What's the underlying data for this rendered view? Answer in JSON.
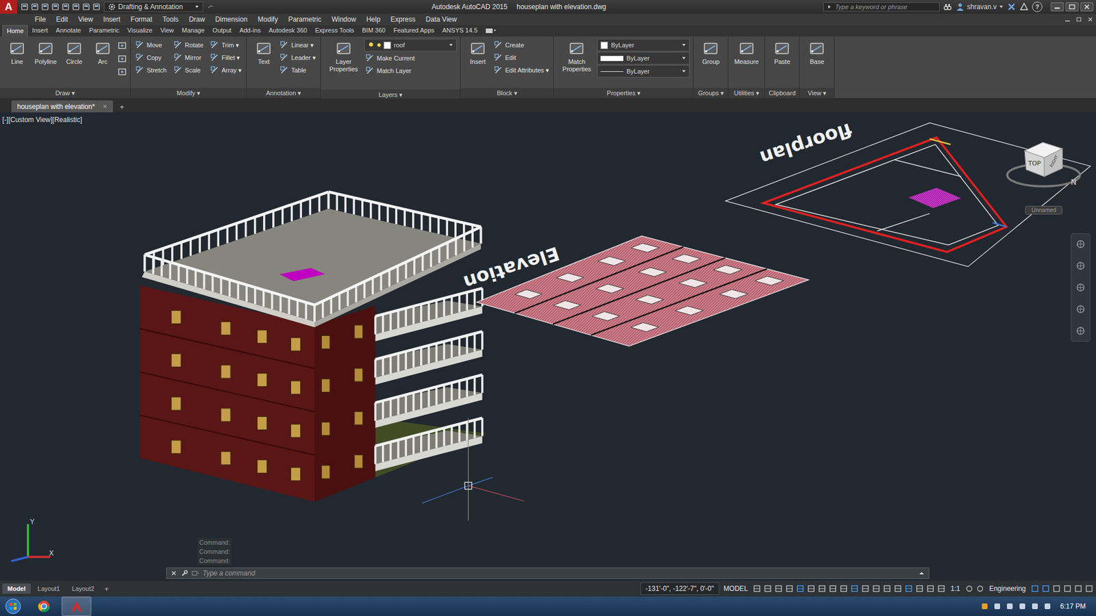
{
  "title_bar": {
    "logo": "A",
    "workspace": "Drafting & Annotation",
    "app": "Autodesk AutoCAD 2015",
    "document": "houseplan with elevation.dwg",
    "search_placeholder": "Type a keyword or phrase",
    "user": "shravan.v",
    "help": "?"
  },
  "menu": [
    "File",
    "Edit",
    "View",
    "Insert",
    "Format",
    "Tools",
    "Draw",
    "Dimension",
    "Modify",
    "Parametric",
    "Window",
    "Help",
    "Express",
    "Data View"
  ],
  "ribbon_tabs": [
    {
      "label": "Home",
      "selected": true
    },
    {
      "label": "Insert",
      "selected": false
    },
    {
      "label": "Annotate",
      "selected": false
    },
    {
      "label": "Parametric",
      "selected": false
    },
    {
      "label": "Visualize",
      "selected": false
    },
    {
      "label": "View",
      "selected": false
    },
    {
      "label": "Manage",
      "selected": false
    },
    {
      "label": "Output",
      "selected": false
    },
    {
      "label": "Add-ins",
      "selected": false
    },
    {
      "label": "Autodesk 360",
      "selected": false
    },
    {
      "label": "Express Tools",
      "selected": false
    },
    {
      "label": "BIM 360",
      "selected": false
    },
    {
      "label": "Featured Apps",
      "selected": false
    },
    {
      "label": "ANSYS 14.5",
      "selected": false
    }
  ],
  "ribbon_panels": [
    {
      "title": "Draw ▾",
      "large": [
        "Line",
        "Polyline",
        "Circle",
        "Arc"
      ],
      "dropdowns": [],
      "small": []
    },
    {
      "title": "Modify ▾",
      "large": [],
      "dropdowns": [],
      "small": [
        "Move",
        "Copy",
        "Stretch",
        "Rotate",
        "Mirror",
        "Scale",
        "Trim ▾",
        "Fillet ▾",
        "Array ▾"
      ]
    },
    {
      "title": "Annotation ▾",
      "large": [
        "Text"
      ],
      "dropdowns": [],
      "small": [
        "Linear ▾",
        "Leader ▾",
        "Table"
      ]
    },
    {
      "title": "Layers ▾",
      "large": [
        "Layer Properties"
      ],
      "dropdowns": [
        {
          "label": "roof",
          "kind": "layer"
        }
      ],
      "small": [
        "Make Current",
        "Match Layer"
      ]
    },
    {
      "title": "Block ▾",
      "large": [
        "Insert"
      ],
      "dropdowns": [],
      "small": [
        "Create",
        "Edit",
        "Edit Attributes ▾"
      ]
    },
    {
      "title": "Properties ▾",
      "large": [
        "Match Properties"
      ],
      "dropdowns": [
        {
          "label": "ByLayer",
          "kind": "color"
        },
        {
          "label": "ByLayer",
          "kind": "lineweight"
        },
        {
          "label": "ByLayer",
          "kind": "linetype"
        }
      ],
      "small": []
    },
    {
      "title": "Groups ▾",
      "large": [
        "Group"
      ],
      "dropdowns": [],
      "small": []
    },
    {
      "title": "Utilities ▾",
      "large": [
        "Measure"
      ],
      "dropdowns": [],
      "small": []
    },
    {
      "title": "Clipboard",
      "large": [
        "Paste"
      ],
      "dropdowns": [],
      "small": []
    },
    {
      "title": "View ▾",
      "large": [
        "Base"
      ],
      "dropdowns": [],
      "small": []
    }
  ],
  "file_tabs": {
    "tabs": [
      {
        "label": "houseplan with elevation*",
        "selected": true
      }
    ],
    "close": "×",
    "add": "+"
  },
  "viewport": {
    "label": "[-][Custom View][Realistic]",
    "elevation_title": "Elevation",
    "floorplan_title": "floorplan",
    "viewcube": {
      "top": "TOP",
      "side": "RIGHT",
      "compass": "N",
      "ucs_menu": "Unnamed"
    },
    "ucs_axes": {
      "x": "X",
      "y": "Y"
    }
  },
  "command_line": {
    "history": [
      "Command:",
      "Command:",
      "Command:"
    ],
    "placeholder": "Type a command"
  },
  "status_bar": {
    "layout_tabs": [
      {
        "label": "Model",
        "selected": true
      },
      {
        "label": "Layout1",
        "selected": false
      },
      {
        "label": "Layout2",
        "selected": false
      }
    ],
    "add": "+",
    "coordinates": "-131'-0\", -122'-7\", 0'-0\"",
    "space": "MODEL",
    "scale": "1:1",
    "workspace": "Engineering"
  },
  "taskbar": {
    "time": "6:17 PM"
  }
}
